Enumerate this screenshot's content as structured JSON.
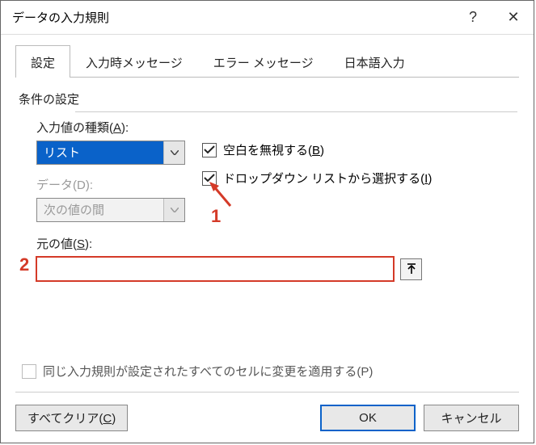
{
  "title": "データの入力規則",
  "helpGlyph": "?",
  "closeGlyph": "✕",
  "tabs": {
    "settings": "設定",
    "input_msg": "入力時メッセージ",
    "error_msg": "エラー メッセージ",
    "ime": "日本語入力"
  },
  "section_label": "条件の設定",
  "allow": {
    "label_pre": "入力値の種類(",
    "label_key": "A",
    "label_post": "):",
    "value": "リスト"
  },
  "data": {
    "label_pre": "データ(",
    "label_key": "D",
    "label_post": "):",
    "value": "次の値の間"
  },
  "cb_ignore_blank": {
    "pre": "空白を無視する(",
    "key": "B",
    "post": ")"
  },
  "cb_dropdown": {
    "pre": "ドロップダウン リストから選択する(",
    "key": "I",
    "post": ")"
  },
  "source": {
    "label_pre": "元の値(",
    "label_key": "S",
    "label_post": "):",
    "value": ""
  },
  "apply_all": {
    "pre": "同じ入力規則が設定されたすべてのセルに変更を適用する(",
    "key": "P",
    "post": ")"
  },
  "buttons": {
    "clear_pre": "すべてクリア(",
    "clear_key": "C",
    "clear_post": ")",
    "ok": "OK",
    "cancel": "キャンセル"
  },
  "annotations": {
    "one": "1",
    "two": "2"
  }
}
